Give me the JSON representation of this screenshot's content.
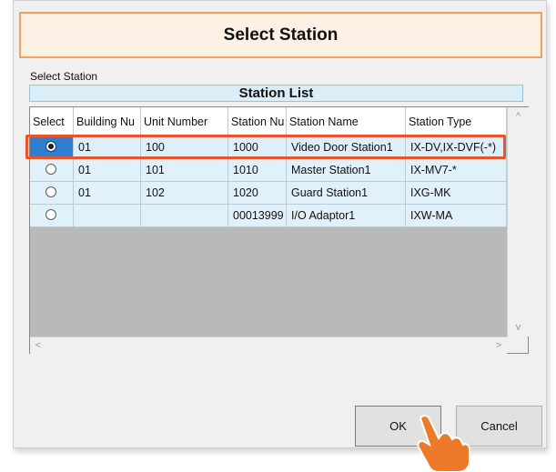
{
  "dialog": {
    "title": "Select Station",
    "section_label": "Select Station"
  },
  "station_list": {
    "header": "Station List",
    "columns": [
      "Select",
      "Building Nu",
      "Unit Number",
      "Station Nu",
      "Station Name",
      "Station Type"
    ],
    "rows": [
      {
        "selected": true,
        "building": "01",
        "unit": "100",
        "station_number": "1000",
        "name": "Video Door Station1",
        "type": "IX-DV,IX-DVF(-*)"
      },
      {
        "selected": false,
        "building": "01",
        "unit": "101",
        "station_number": "1010",
        "name": "Master Station1",
        "type": "IX-MV7-*"
      },
      {
        "selected": false,
        "building": "01",
        "unit": "102",
        "station_number": "1020",
        "name": "Guard Station1",
        "type": "IXG-MK"
      },
      {
        "selected": false,
        "building": "",
        "unit": "",
        "station_number": "00013999",
        "name": "I/O Adaptor1",
        "type": "IXW-MA"
      }
    ]
  },
  "scrollbars": {
    "up_icon": "^",
    "down_icon": "v",
    "left_icon": "<",
    "right_icon": ">"
  },
  "buttons": {
    "ok": "OK",
    "cancel": "Cancel"
  },
  "colors": {
    "title_border": "#f4a05a",
    "title_bg": "#fdf0e5",
    "row_bg": "#e0f1f9",
    "selected_cell": "#2e7fd0",
    "highlight": "#e8552a",
    "hand": "#ec7a2a"
  }
}
